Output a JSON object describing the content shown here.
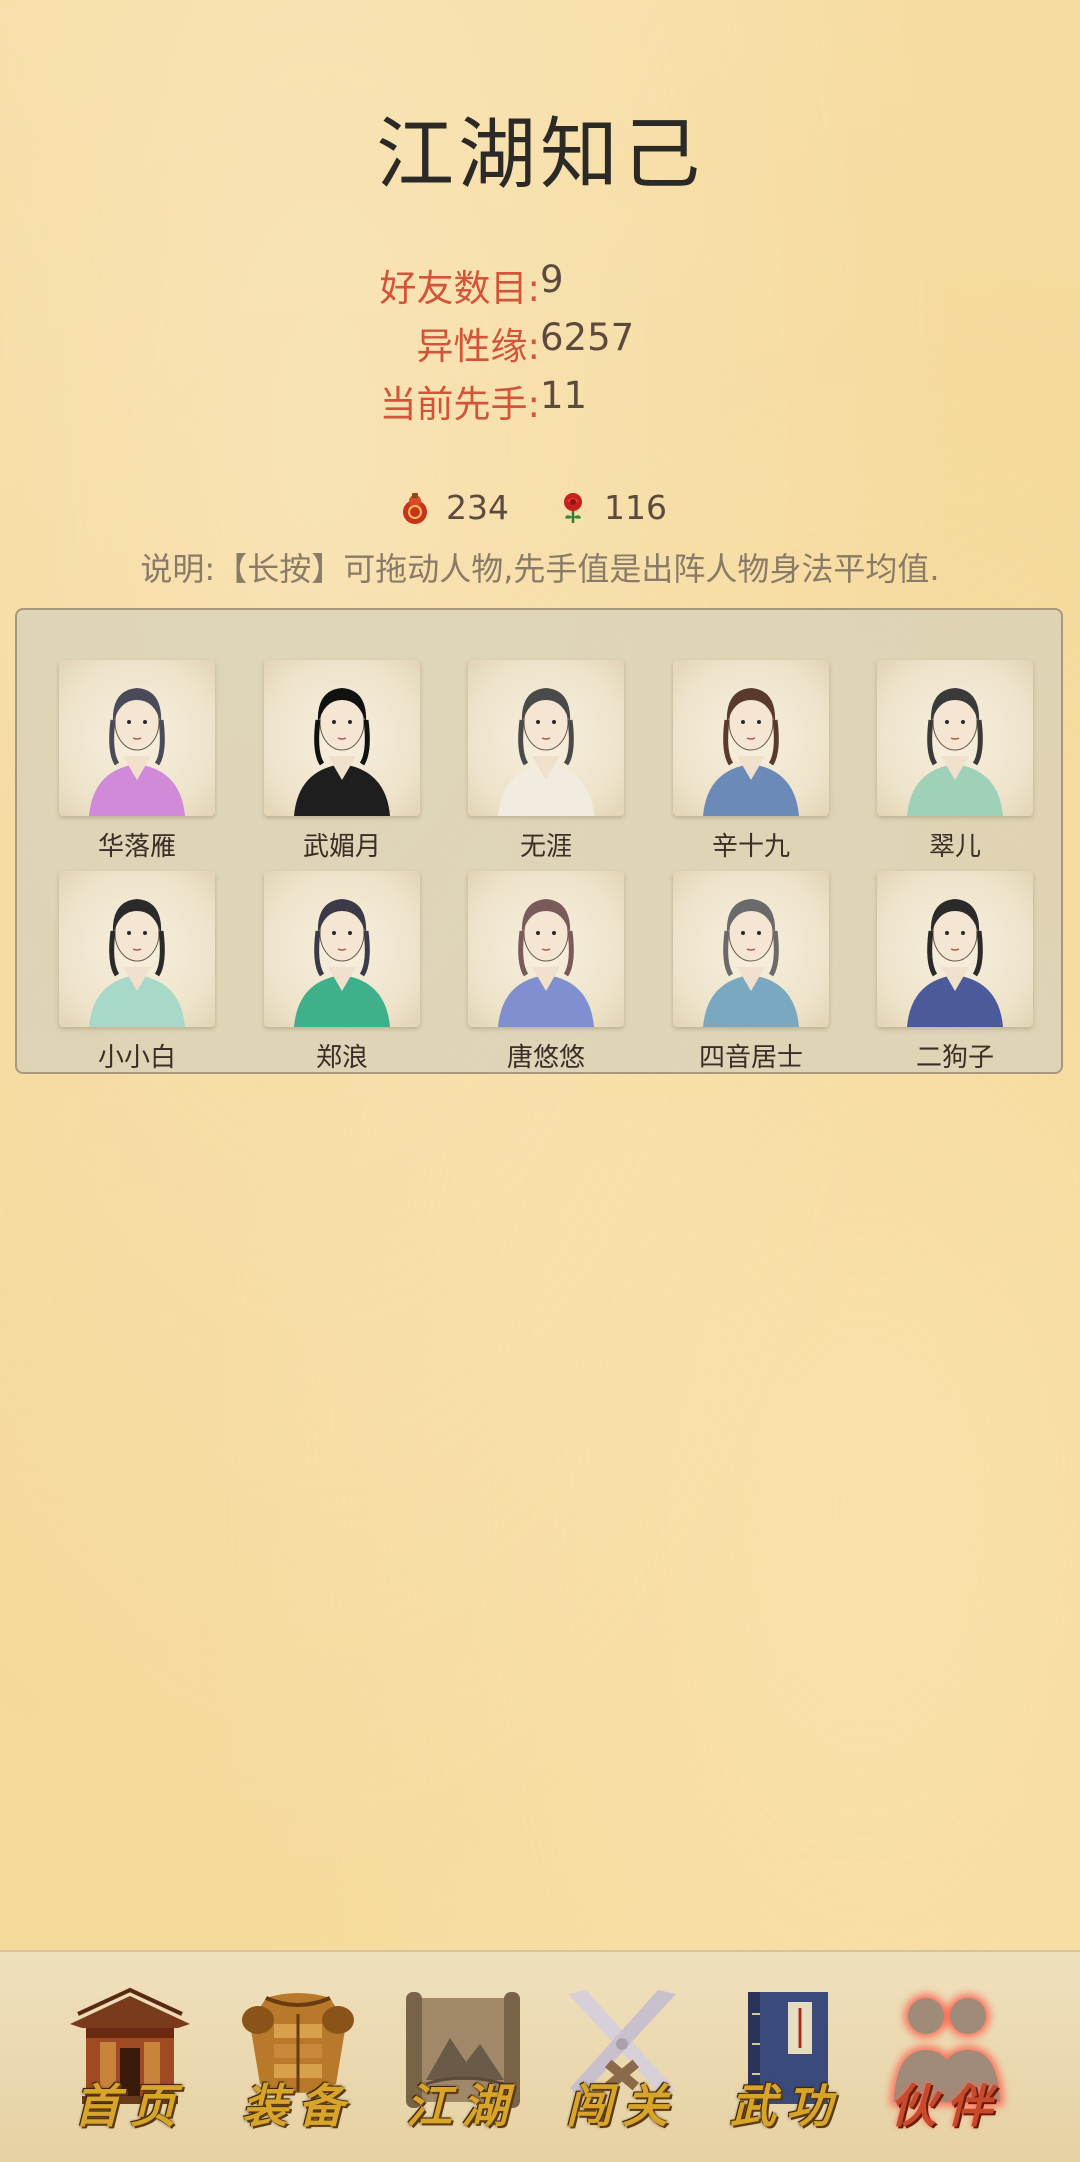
{
  "title": "江湖知己",
  "stats": [
    {
      "label": "好友数目:",
      "value": "9"
    },
    {
      "label": "异性缘:",
      "value": "6257"
    },
    {
      "label": "当前先手:",
      "value": "11"
    }
  ],
  "currency": [
    {
      "icon": "gourd-icon",
      "value": "234",
      "color": "#c8321e"
    },
    {
      "icon": "rose-icon",
      "value": "116",
      "color": "#c8201e"
    }
  ],
  "note": "说明:【长按】可拖动人物,先手值是出阵人物身法平均值.",
  "characters": [
    {
      "name": "华落雁",
      "robe": "#d08ad8",
      "hair": "#4a4a5a"
    },
    {
      "name": "武媚月",
      "robe": "#1e1e1e",
      "hair": "#111111"
    },
    {
      "name": "无涯",
      "robe": "#f2ece0",
      "hair": "#4a4a4a"
    },
    {
      "name": "辛十九",
      "robe": "#6b8ab8",
      "hair": "#5a3a2a"
    },
    {
      "name": "翠儿",
      "robe": "#9fd0b8",
      "hair": "#3a3a3a"
    },
    {
      "name": "小小白",
      "robe": "#a8d8c8",
      "hair": "#2a2a2a"
    },
    {
      "name": "郑浪",
      "robe": "#3fb08a",
      "hair": "#3a3a48"
    },
    {
      "name": "唐悠悠",
      "robe": "#7f8fcf",
      "hair": "#7a5a5a"
    },
    {
      "name": "四音居士",
      "robe": "#7aa8c0",
      "hair": "#6a6a6a"
    },
    {
      "name": "二狗子",
      "robe": "#4a5a9a",
      "hair": "#2a2a2a"
    }
  ],
  "nav": [
    {
      "label": "首页",
      "icon": "house-icon",
      "active": false
    },
    {
      "label": "装备",
      "icon": "armor-icon",
      "active": false
    },
    {
      "label": "江湖",
      "icon": "scroll-icon",
      "active": false
    },
    {
      "label": "闯关",
      "icon": "crossed-swords-icon",
      "active": false
    },
    {
      "label": "武功",
      "icon": "book-icon",
      "active": false
    },
    {
      "label": "伙伴",
      "icon": "companions-icon",
      "active": true
    }
  ]
}
